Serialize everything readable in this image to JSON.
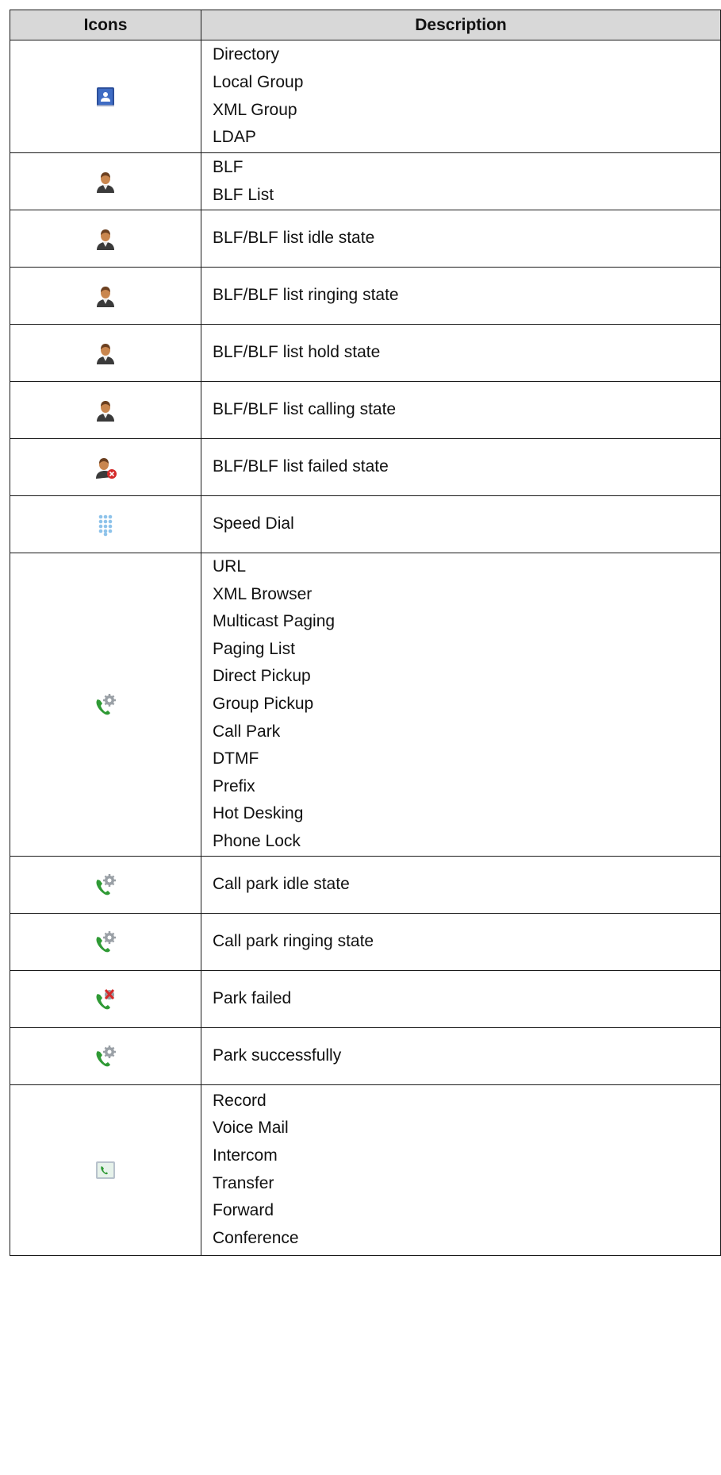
{
  "table": {
    "headers": [
      "Icons",
      "Description"
    ],
    "rows": [
      {
        "icon": "directory-book-icon",
        "lines": [
          "Directory",
          "Local Group",
          "XML Group",
          "LDAP"
        ]
      },
      {
        "icon": "blf-person-icon",
        "lines": [
          "BLF",
          "BLF List"
        ]
      },
      {
        "icon": "blf-idle-person-icon",
        "lines": [
          "BLF/BLF list idle state"
        ]
      },
      {
        "icon": "blf-ringing-person-icon",
        "lines": [
          "BLF/BLF list ringing state"
        ]
      },
      {
        "icon": "blf-hold-person-icon",
        "lines": [
          "BLF/BLF list hold state"
        ]
      },
      {
        "icon": "blf-calling-person-icon",
        "lines": [
          "BLF/BLF list calling state"
        ]
      },
      {
        "icon": "blf-failed-person-icon",
        "lines": [
          "BLF/BLF list failed state"
        ]
      },
      {
        "icon": "speed-dial-keypad-icon",
        "lines": [
          "Speed Dial"
        ]
      },
      {
        "icon": "phone-gear-icon",
        "lines": [
          "URL",
          "XML Browser",
          "Multicast Paging",
          "Paging List",
          "Direct Pickup",
          "Group Pickup",
          "Call Park",
          "DTMF",
          "Prefix",
          "Hot Desking",
          "Phone Lock"
        ]
      },
      {
        "icon": "call-park-idle-icon",
        "lines": [
          "Call park idle state"
        ]
      },
      {
        "icon": "call-park-ringing-icon",
        "lines": [
          "Call park ringing state"
        ]
      },
      {
        "icon": "park-failed-icon",
        "lines": [
          "Park failed"
        ]
      },
      {
        "icon": "park-success-icon",
        "lines": [
          "Park successfully"
        ]
      },
      {
        "icon": "phone-card-icon",
        "lines": [
          "Record",
          "Voice Mail",
          "Intercom",
          "Transfer",
          "Forward",
          "Conference"
        ]
      }
    ]
  },
  "colors": {
    "header_bg": "#d8d8d8",
    "border": "#1a1a1a",
    "directory_blue": "#2c4f9a",
    "person_skin": "#c9864e",
    "failed_red": "#d42a2a",
    "keypad_blue": "#8ec3ea",
    "phone_green": "#2f9a35",
    "gear_gray": "#9aa0a6"
  }
}
